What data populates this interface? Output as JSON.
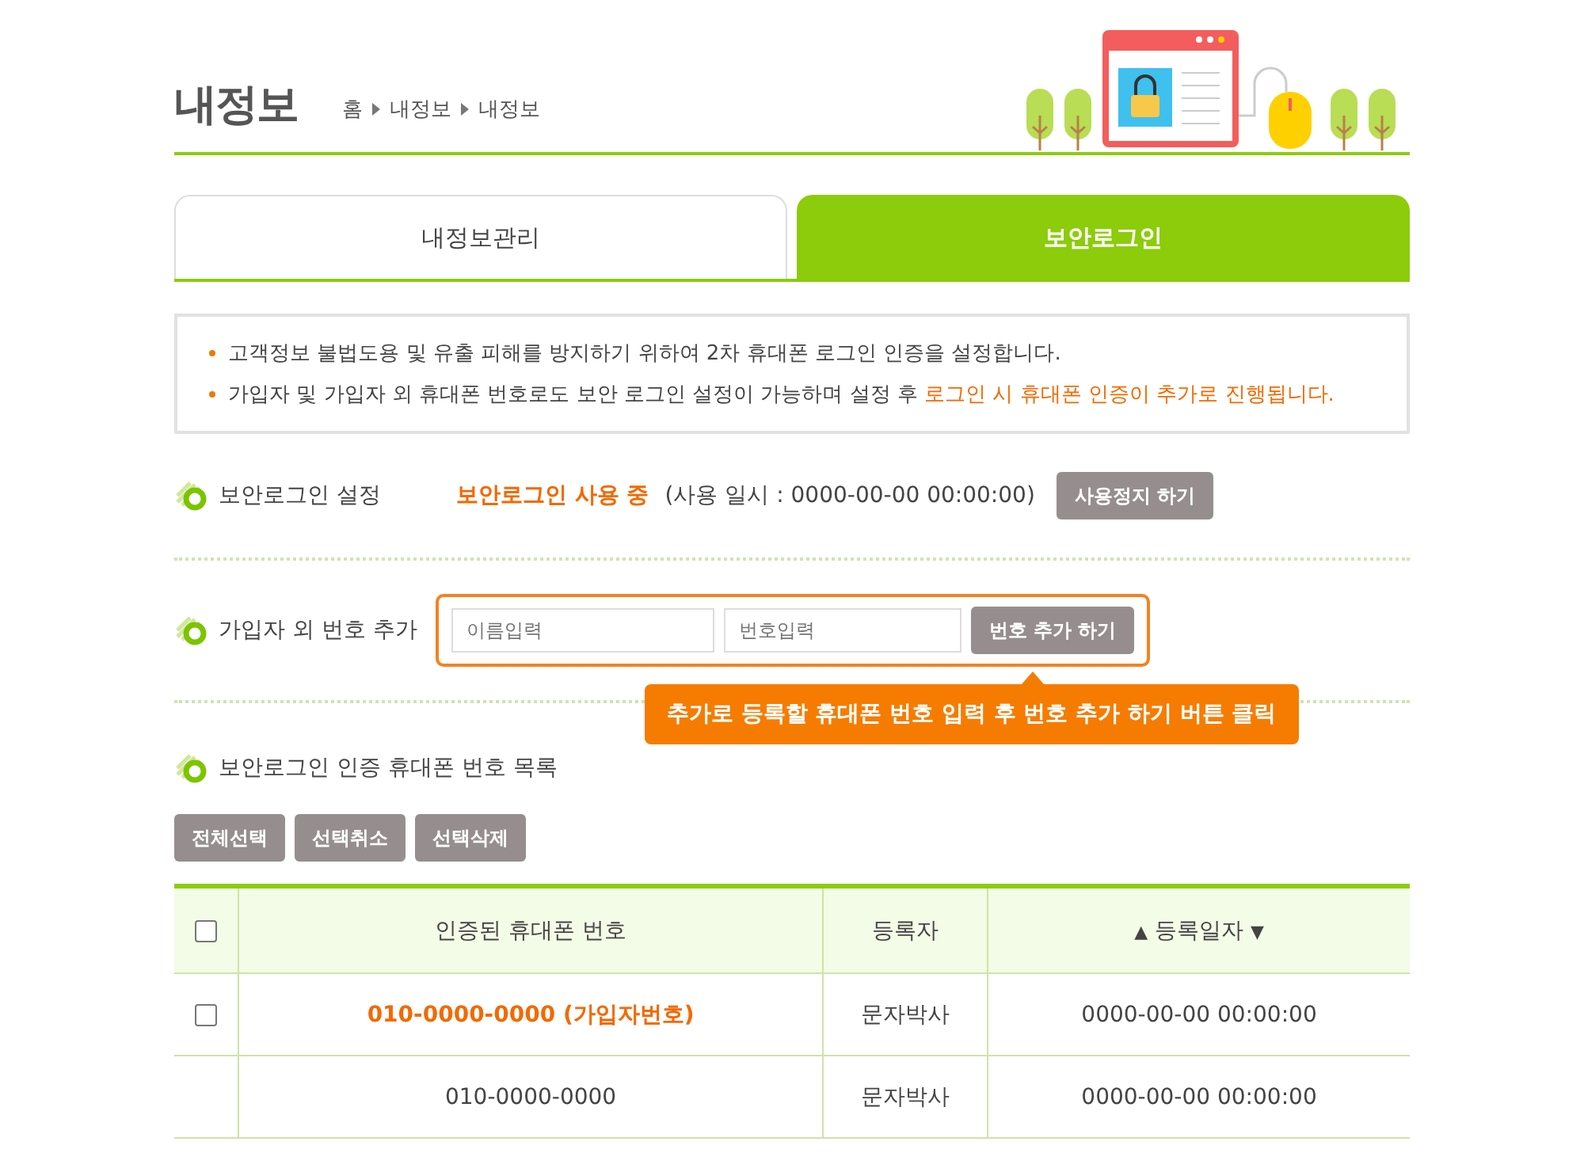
{
  "page_title": "내정보",
  "breadcrumb": [
    "홈",
    "내정보",
    "내정보"
  ],
  "tabs": [
    {
      "label": "내정보관리",
      "selected": false
    },
    {
      "label": "보안로그인",
      "selected": true
    }
  ],
  "notices": [
    {
      "text": "고객정보 불법도용 및 유출 피해를 방지하기 위하여 2차 휴대폰 로그인 인증을 설정합니다."
    },
    {
      "text": "가입자 및 가입자 외 휴대폰 번호로도 보안 로그인 설정이 가능하며 설정 후 ",
      "emphasis": "로그인 시 휴대폰 인증이 추가로 진행됩니다."
    }
  ],
  "setting": {
    "label": "보안로그인 설정",
    "status": "보안로그인 사용 중",
    "usage": "(사용 일시 : 0000-00-00 00:00:00)",
    "button": "사용정지 하기"
  },
  "add_number": {
    "label": "가입자 외 번호 추가",
    "name_field": {
      "placeholder": "이름입력"
    },
    "number_field": {
      "placeholder": "번호입력"
    },
    "button": "번호 추가 하기",
    "tooltip": "추가로 등록할 휴대폰 번호 입력 후 번호 추가 하기 버튼 클릭"
  },
  "list": {
    "label": "보안로그인 인증 휴대폰 번호 목록",
    "buttons": [
      "전체선택",
      "선택취소",
      "선택삭제"
    ],
    "table": {
      "all_checked": false,
      "columns": [
        {
          "label": "인증된 휴대폰 번호"
        },
        {
          "label": "등록자"
        },
        {
          "label": "등록일자",
          "sort_up": "▲",
          "sort_down": "▼"
        }
      ],
      "rows": [
        {
          "checked": false,
          "highlight": true,
          "phone": "010-0000-0000 (가입자번호)",
          "registrant": "문자박사",
          "date": "0000-00-00 00:00:00"
        },
        {
          "highlight": false,
          "phone": "010-0000-0000",
          "registrant": "문자박사",
          "date": "0000-00-00 00:00:00"
        }
      ]
    }
  }
}
